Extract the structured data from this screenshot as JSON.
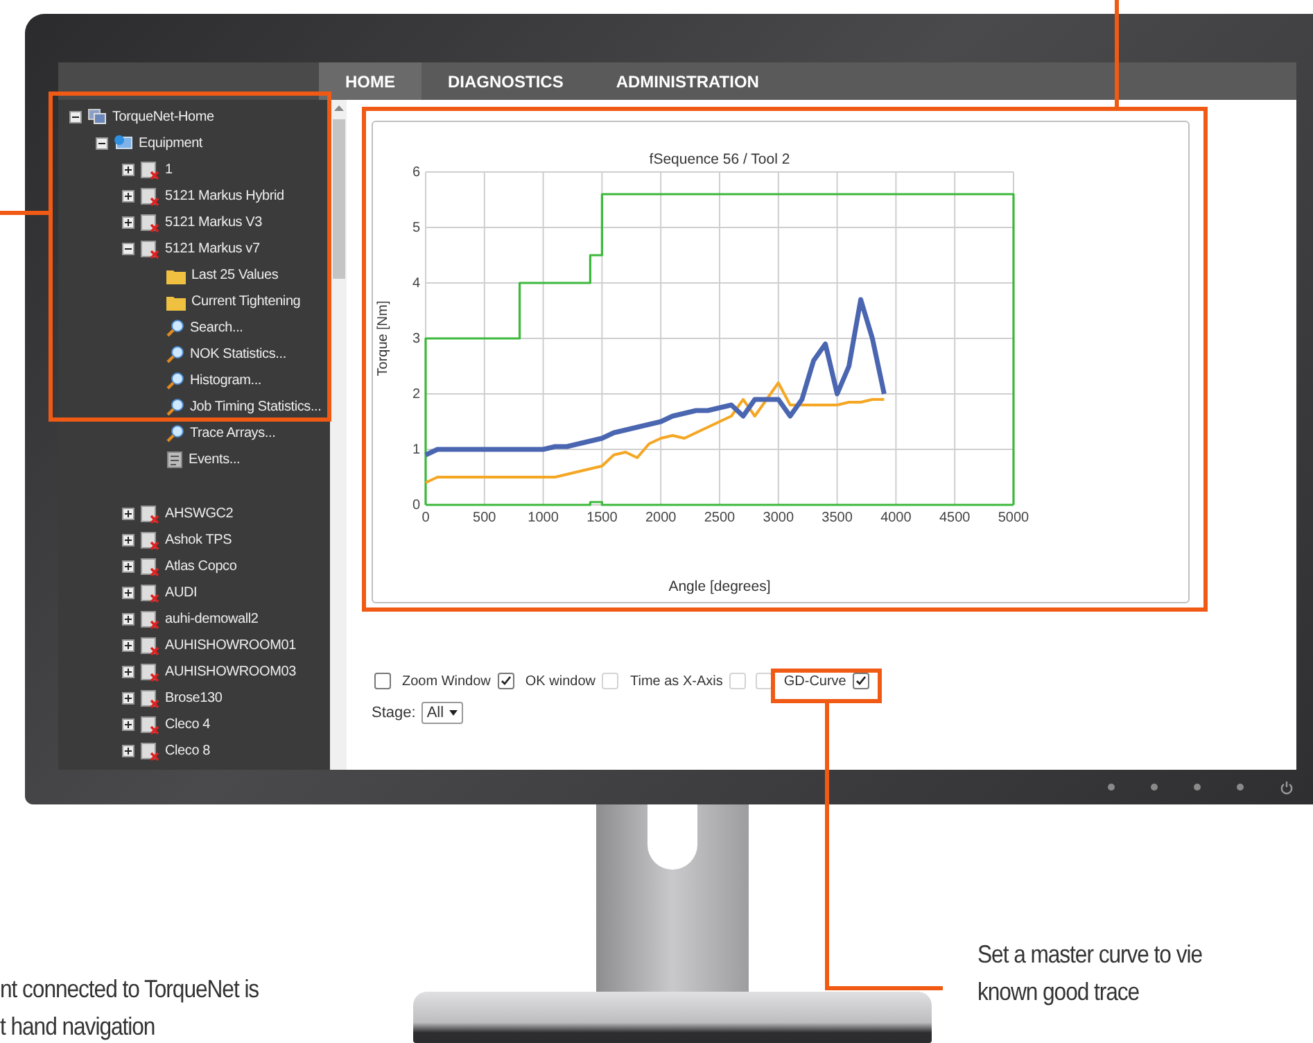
{
  "tabs": [
    {
      "label": "HOME",
      "selected": true
    },
    {
      "label": "DIAGNOSTICS",
      "selected": false
    },
    {
      "label": "ADMINISTRATION",
      "selected": false
    }
  ],
  "tree": [
    {
      "label": "TorqueNet-Home",
      "kind": "root",
      "expanded": true,
      "children": [
        {
          "label": "Equipment",
          "kind": "group",
          "expanded": true,
          "children": [
            {
              "label": "1",
              "kind": "tool",
              "expanded": false
            },
            {
              "label": "5121 Markus Hybrid",
              "kind": "tool",
              "expanded": false
            },
            {
              "label": "5121 Markus V3",
              "kind": "tool",
              "expanded": false
            },
            {
              "label": "5121 Markus v7",
              "kind": "tool",
              "expanded": true,
              "children": [
                {
                  "label": "Last 25 Values",
                  "kind": "folder"
                },
                {
                  "label": "Current Tightening",
                  "kind": "folder"
                },
                {
                  "label": "Search...",
                  "kind": "search"
                },
                {
                  "label": "NOK Statistics...",
                  "kind": "search"
                },
                {
                  "label": "Histogram...",
                  "kind": "search"
                },
                {
                  "label": "Job Timing Statistics...",
                  "kind": "search"
                },
                {
                  "label": "Trace Arrays...",
                  "kind": "search"
                },
                {
                  "label": "Events...",
                  "kind": "events"
                }
              ]
            },
            {
              "label": "AHSWGC2",
              "kind": "tool",
              "expanded": false
            },
            {
              "label": "Ashok TPS",
              "kind": "tool",
              "expanded": false
            },
            {
              "label": "Atlas Copco",
              "kind": "tool",
              "expanded": false
            },
            {
              "label": "AUDI",
              "kind": "tool",
              "expanded": false
            },
            {
              "label": "auhi-demowall2",
              "kind": "tool",
              "expanded": false
            },
            {
              "label": "AUHISHOWROOM01",
              "kind": "tool",
              "expanded": false
            },
            {
              "label": "AUHISHOWROOM03",
              "kind": "tool",
              "expanded": false
            },
            {
              "label": "Brose130",
              "kind": "tool",
              "expanded": false
            },
            {
              "label": "Cleco 4",
              "kind": "tool",
              "expanded": false
            },
            {
              "label": "Cleco 8",
              "kind": "tool",
              "expanded": false
            }
          ]
        }
      ]
    }
  ],
  "chart": {
    "chart_data": {
      "type": "line",
      "title": "fSequence 56 / Tool 2",
      "xlabel": "Angle [degrees]",
      "ylabel": "Torque [Nm]",
      "grid": true,
      "x": [
        0,
        0,
        100,
        200,
        300,
        400,
        500,
        600,
        700,
        800,
        800,
        900,
        1000,
        1100,
        1200,
        1300,
        1400,
        1400,
        1500,
        1500,
        1600,
        1700,
        1800,
        1900,
        2000,
        2100,
        2200,
        2300,
        2400,
        2500,
        2600,
        2700,
        2800,
        2900,
        3000,
        3100,
        3200,
        3300,
        3400,
        3500,
        3600,
        3700,
        3800,
        3900,
        4000,
        4100,
        4200,
        4300,
        4400,
        4500,
        4600,
        4700,
        4800,
        4900,
        5000,
        5000
      ],
      "series": [
        {
          "color": "#3cb83c",
          "values": [
            0,
            3,
            3,
            3,
            3,
            3,
            3,
            3,
            3,
            3,
            4,
            4,
            4,
            4,
            4,
            4,
            4,
            4.5,
            4.5,
            5.6,
            5.6,
            5.6,
            5.6,
            5.6,
            5.6,
            5.6,
            5.6,
            5.6,
            5.6,
            5.6,
            5.6,
            5.6,
            5.6,
            5.6,
            5.6,
            5.6,
            5.6,
            5.6,
            5.6,
            5.6,
            5.6,
            5.6,
            5.6,
            5.6,
            5.6,
            5.6,
            5.6,
            5.6,
            5.6,
            5.6,
            5.6,
            5.6,
            5.6,
            5.6,
            5.6,
            0
          ]
        },
        {
          "color": "#3cb83c",
          "values": [
            0,
            0,
            0,
            0,
            0,
            0,
            0,
            0,
            0,
            0,
            0,
            0,
            0,
            0,
            0,
            0,
            0,
            0.05,
            0.05,
            0,
            0,
            0,
            0,
            0,
            0,
            0,
            0,
            0,
            0,
            0,
            0,
            0,
            0,
            0,
            0,
            0,
            0,
            0,
            0,
            0,
            0,
            0,
            0,
            0,
            0,
            0,
            0,
            0,
            0,
            0,
            0,
            0,
            0,
            0,
            0,
            0
          ]
        },
        {
          "color": "#f5a623",
          "values": [
            0.4,
            0.4,
            0.5,
            0.5,
            0.5,
            0.5,
            0.5,
            0.5,
            0.5,
            0.5,
            0.5,
            0.5,
            0.5,
            0.5,
            0.55,
            0.6,
            0.65,
            0.65,
            0.7,
            0.7,
            0.9,
            0.95,
            0.85,
            1.1,
            1.2,
            1.25,
            1.2,
            1.3,
            1.4,
            1.5,
            1.6,
            1.9,
            1.6,
            1.9,
            2.2,
            1.8,
            1.8,
            1.8,
            1.8,
            1.8,
            1.85,
            1.85,
            1.9,
            1.9,
            null,
            null,
            null,
            null,
            null,
            null,
            null,
            null,
            null,
            null,
            null,
            null
          ]
        },
        {
          "color": "#4a66b0",
          "values": [
            0.9,
            0.9,
            1,
            1,
            1,
            1,
            1,
            1,
            1,
            1,
            1,
            1,
            1,
            1.05,
            1.05,
            1.1,
            1.15,
            1.15,
            1.2,
            1.2,
            1.3,
            1.35,
            1.4,
            1.45,
            1.5,
            1.6,
            1.65,
            1.7,
            1.7,
            1.75,
            1.8,
            1.6,
            1.9,
            1.9,
            1.9,
            1.6,
            1.9,
            2.6,
            2.9,
            2,
            2.5,
            3.7,
            3,
            2,
            null,
            null,
            null,
            null,
            null,
            null,
            null,
            null,
            null,
            null,
            null,
            null
          ]
        }
      ],
      "xlim": [
        0,
        5000
      ],
      "ylim": [
        0,
        6
      ],
      "xticks": [
        0,
        500,
        1000,
        1500,
        2000,
        2500,
        3000,
        3500,
        4000,
        4500,
        5000
      ],
      "yticks": [
        0,
        1,
        2,
        3,
        4,
        5,
        6
      ]
    }
  },
  "chart_options": [
    {
      "kind": "checkbox",
      "checked": false,
      "disabled": false
    },
    {
      "kind": "label",
      "text": "Zoom Window"
    },
    {
      "kind": "checkbox",
      "checked": true,
      "disabled": false
    },
    {
      "kind": "label",
      "text": "OK window"
    },
    {
      "kind": "checkbox",
      "checked": false,
      "disabled": true
    },
    {
      "kind": "label",
      "text": "Time as X-Axis"
    },
    {
      "kind": "checkbox",
      "checked": false,
      "disabled": true
    },
    {
      "kind": "checkbox",
      "checked": false,
      "disabled": true
    },
    {
      "kind": "label",
      "text": "GD-Curve"
    },
    {
      "kind": "checkbox",
      "checked": true,
      "disabled": false
    }
  ],
  "stage": {
    "label": "Stage:",
    "value": "All"
  },
  "callouts": [
    {
      "lines": [
        "nt connected to TorqueNet is",
        "t hand navigation"
      ]
    },
    {
      "lines": [
        "Set a master curve to vie",
        "known good trace"
      ]
    }
  ]
}
